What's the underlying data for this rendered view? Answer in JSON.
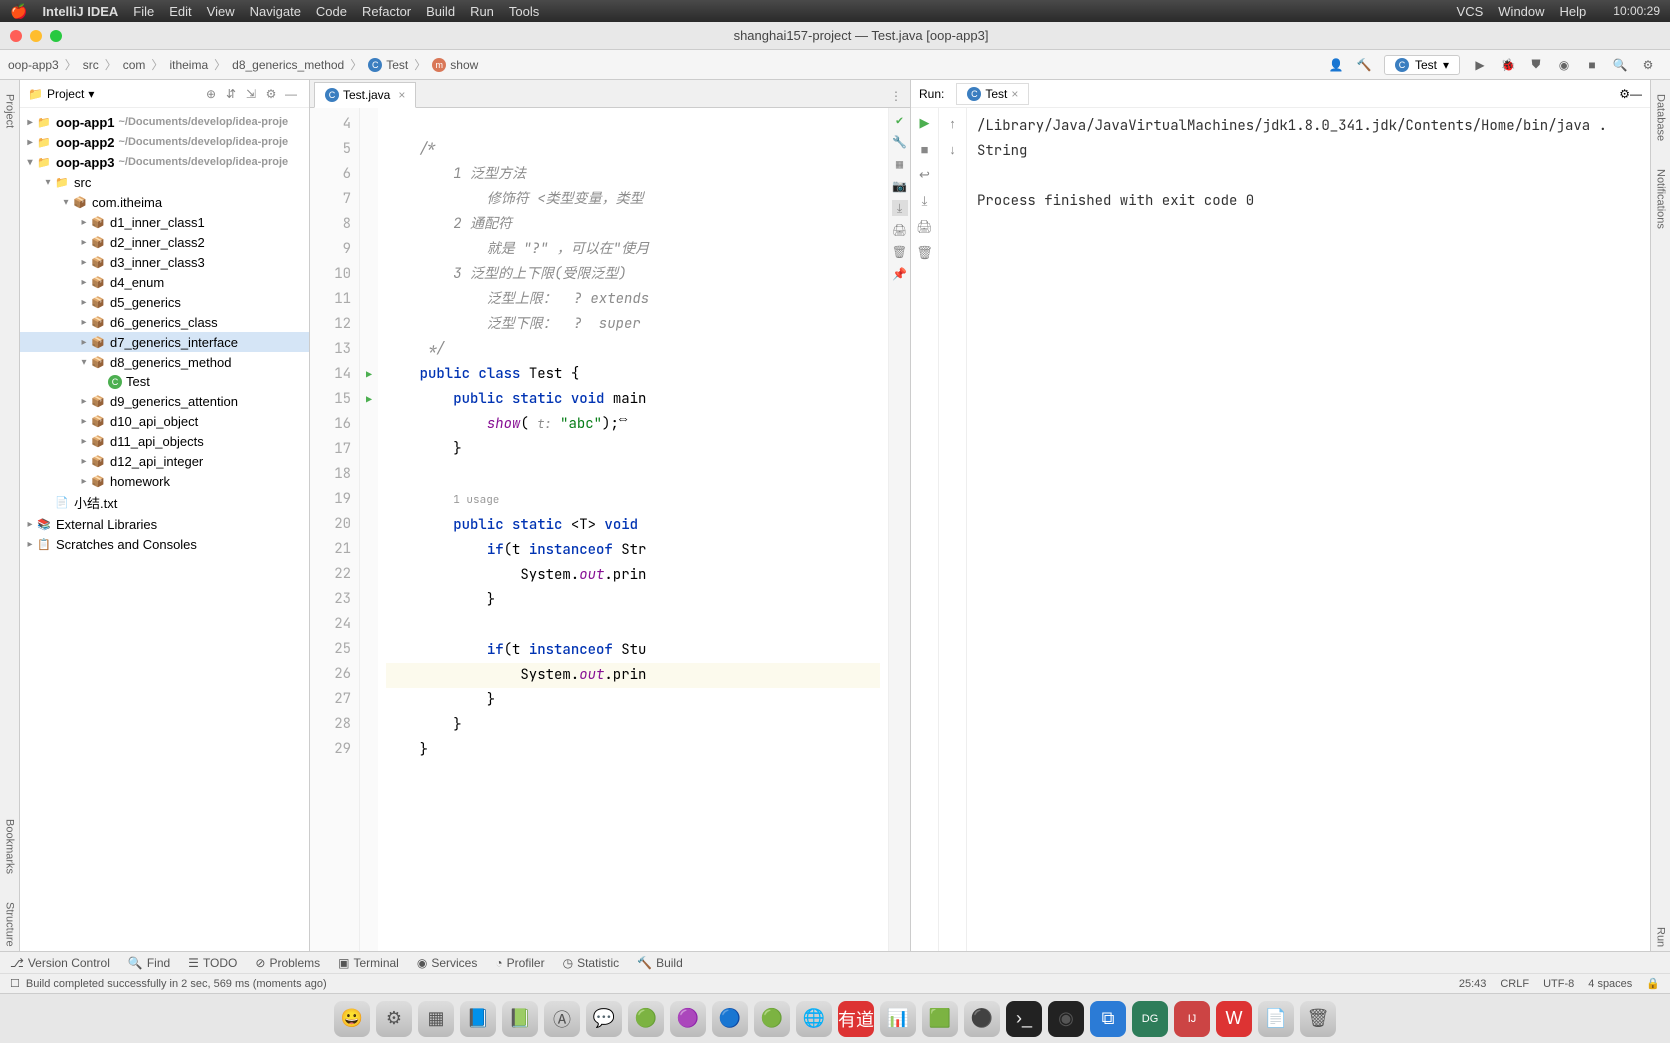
{
  "menubar": {
    "app_name": "IntelliJ IDEA",
    "items": [
      "File",
      "Edit",
      "View",
      "Navigate",
      "Code",
      "Refactor",
      "Build",
      "Run",
      "Tools"
    ],
    "right_items": [
      "VCS",
      "Window",
      "Help"
    ],
    "clock": "10:00:29"
  },
  "window": {
    "title": "shanghai157-project — Test.java [oop-app3]"
  },
  "breadcrumb": [
    "oop-app3",
    "src",
    "com",
    "itheima",
    "d8_generics_method",
    "Test",
    "show"
  ],
  "toolbar": {
    "run_config": "Test"
  },
  "project_panel": {
    "title": "Project",
    "tree": [
      {
        "indent": 0,
        "arrow": "▸",
        "icon": "folder",
        "label": "oop-app1",
        "hint": "~/Documents/develop/idea-proje",
        "bold": true
      },
      {
        "indent": 0,
        "arrow": "▸",
        "icon": "folder",
        "label": "oop-app2",
        "hint": "~/Documents/develop/idea-proje",
        "bold": true
      },
      {
        "indent": 0,
        "arrow": "▾",
        "icon": "folder",
        "label": "oop-app3",
        "hint": "~/Documents/develop/idea-proje",
        "bold": true
      },
      {
        "indent": 1,
        "arrow": "▾",
        "icon": "folder",
        "label": "src"
      },
      {
        "indent": 2,
        "arrow": "▾",
        "icon": "pkg",
        "label": "com.itheima"
      },
      {
        "indent": 3,
        "arrow": "▸",
        "icon": "pkg",
        "label": "d1_inner_class1"
      },
      {
        "indent": 3,
        "arrow": "▸",
        "icon": "pkg",
        "label": "d2_inner_class2"
      },
      {
        "indent": 3,
        "arrow": "▸",
        "icon": "pkg",
        "label": "d3_inner_class3"
      },
      {
        "indent": 3,
        "arrow": "▸",
        "icon": "pkg",
        "label": "d4_enum"
      },
      {
        "indent": 3,
        "arrow": "▸",
        "icon": "pkg",
        "label": "d5_generics"
      },
      {
        "indent": 3,
        "arrow": "▸",
        "icon": "pkg",
        "label": "d6_generics_class"
      },
      {
        "indent": 3,
        "arrow": "▸",
        "icon": "pkg",
        "label": "d7_generics_interface",
        "selected": true
      },
      {
        "indent": 3,
        "arrow": "▾",
        "icon": "pkg",
        "label": "d8_generics_method"
      },
      {
        "indent": 4,
        "arrow": "",
        "icon": "class",
        "label": "Test"
      },
      {
        "indent": 3,
        "arrow": "▸",
        "icon": "pkg",
        "label": "d9_generics_attention"
      },
      {
        "indent": 3,
        "arrow": "▸",
        "icon": "pkg",
        "label": "d10_api_object"
      },
      {
        "indent": 3,
        "arrow": "▸",
        "icon": "pkg",
        "label": "d11_api_objects"
      },
      {
        "indent": 3,
        "arrow": "▸",
        "icon": "pkg",
        "label": "d12_api_integer"
      },
      {
        "indent": 3,
        "arrow": "▸",
        "icon": "pkg",
        "label": "homework"
      },
      {
        "indent": 1,
        "arrow": "",
        "icon": "file",
        "label": "小结.txt"
      },
      {
        "indent": 0,
        "arrow": "▸",
        "icon": "lib",
        "label": "External Libraries"
      },
      {
        "indent": 0,
        "arrow": "▸",
        "icon": "scratch",
        "label": "Scratches and Consoles"
      }
    ]
  },
  "editor": {
    "tab": "Test.java",
    "line_start": 4,
    "lines": [
      {
        "n": 4,
        "raw": ""
      },
      {
        "n": 5,
        "raw": "    /*",
        "cmt": true
      },
      {
        "n": 6,
        "raw": "        1 泛型方法",
        "cmt": true
      },
      {
        "n": 7,
        "raw": "            修饰符 <类型变量，类型",
        "cmt": true
      },
      {
        "n": 8,
        "raw": "        2 通配符",
        "cmt": true
      },
      {
        "n": 9,
        "raw": "            就是 \"?\" ，可以在\"使月",
        "cmt": true
      },
      {
        "n": 10,
        "raw": "        3 泛型的上下限(受限泛型)",
        "cmt": true
      },
      {
        "n": 11,
        "raw": "            泛型上限：  ? extends",
        "cmt": true
      },
      {
        "n": 12,
        "raw": "            泛型下限：  ?  super",
        "cmt": true
      },
      {
        "n": 13,
        "raw": "     */",
        "cmt": true
      },
      {
        "n": 14,
        "run": true,
        "html": "    <span class='kw'>public</span> <span class='kw'>class</span> Test {"
      },
      {
        "n": 15,
        "run": true,
        "html": "        <span class='kw'>public</span> <span class='kw'>static</span> <span class='kw'>void</span> main"
      },
      {
        "n": 16,
        "html": "            <span class='fld'>show</span>( <span class='hint'>t:</span> <span class='str'>\"abc\"</span>);"
      },
      {
        "n": 17,
        "raw": "        }"
      },
      {
        "n": 18,
        "raw": ""
      },
      {
        "n": "",
        "html": "        <span class='usage'>1 usage</span>"
      },
      {
        "n": 19,
        "html": "        <span class='kw'>public</span> <span class='kw'>static</span> &lt;T&gt; <span class='kw'>void</span>"
      },
      {
        "n": 20,
        "html": "            <span class='kw'>if</span>(t <span class='kw'>instanceof</span> Str"
      },
      {
        "n": 21,
        "html": "                System.<span class='fld'>out</span>.prin"
      },
      {
        "n": 22,
        "raw": "            }"
      },
      {
        "n": 23,
        "raw": ""
      },
      {
        "n": 24,
        "html": "            <span class='kw'>if</span>(t <span class='kw'>instanceof</span> Stu"
      },
      {
        "n": 25,
        "hl": true,
        "html": "                System.<span class='fld'>out</span>.prin"
      },
      {
        "n": 26,
        "raw": "            }"
      },
      {
        "n": 27,
        "raw": "        }"
      },
      {
        "n": 28,
        "raw": "    }"
      },
      {
        "n": 29,
        "raw": ""
      }
    ]
  },
  "run": {
    "title": "Run:",
    "tab": "Test",
    "console": "/Library/Java/JavaVirtualMachines/jdk1.8.0_341.jdk/Contents/Home/bin/java .\nString\n\nProcess finished with exit code 0"
  },
  "bottom_tools": [
    "Version Control",
    "Find",
    "TODO",
    "Problems",
    "Terminal",
    "Services",
    "Profiler",
    "Statistic",
    "Build"
  ],
  "status": {
    "msg": "Build completed successfully in 2 sec, 569 ms (moments ago)",
    "pos": "25:43",
    "eol": "CRLF",
    "enc": "UTF-8",
    "indent": "4 spaces"
  },
  "right_gutter": [
    "Database",
    "Notifications",
    "Run"
  ],
  "left_gutter": [
    "Project",
    "Bookmarks",
    "Structure"
  ]
}
